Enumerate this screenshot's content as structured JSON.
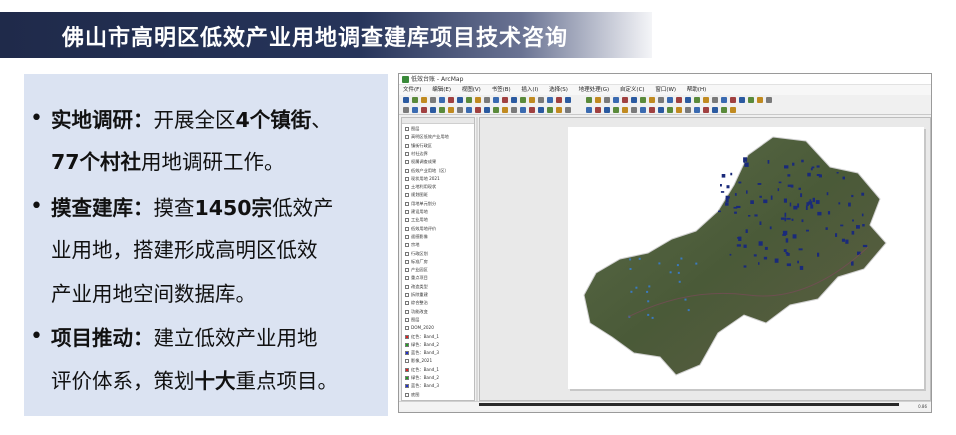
{
  "slide": {
    "title": "佛山市高明区低效产业用地调查建库项目技术咨询"
  },
  "bullets": [
    {
      "lines": [
        [
          {
            "t": "实地调研：",
            "b": true
          },
          {
            "t": "开展全区",
            "b": false
          },
          {
            "t": "4个镇街",
            "b": true
          },
          {
            "t": "、",
            "b": false
          }
        ],
        [
          {
            "t": "77个村社",
            "b": true
          },
          {
            "t": "用地调研工作。",
            "b": false
          }
        ]
      ]
    },
    {
      "lines": [
        [
          {
            "t": "摸查建库：",
            "b": true
          },
          {
            "t": "摸查",
            "b": false
          },
          {
            "t": "1450宗",
            "b": true
          },
          {
            "t": "低效产",
            "b": false
          }
        ],
        [
          {
            "t": "业用地，搭建形成高明区低效",
            "b": false
          }
        ],
        [
          {
            "t": "产业用地空间数据库。",
            "b": false
          }
        ]
      ]
    },
    {
      "lines": [
        [
          {
            "t": "项目推动：",
            "b": true
          },
          {
            "t": "建立低效产业用地",
            "b": false
          }
        ],
        [
          {
            "t": "评价体系，策划",
            "b": false
          },
          {
            "t": "十大",
            "b": true
          },
          {
            "t": "重点项目。",
            "b": false
          }
        ]
      ]
    }
  ],
  "screenshot": {
    "title": "低效台账 - ArcMap",
    "menu": [
      "文件(F)",
      "编辑(E)",
      "视图(V)",
      "书签(B)",
      "插入(I)",
      "选择(S)",
      "地理处理(G)",
      "自定义(C)",
      "窗口(W)",
      "帮助(H)"
    ],
    "status": "0.86",
    "toc_items": [
      "图层",
      "高明区低效产业用地",
      "镇街行政区",
      "村社边界",
      "权属调查成果",
      "低效产业用地（区）",
      "现状用地 2021",
      "土地利用现状",
      "规划图斑",
      "用地单元划分",
      "建设用地",
      "工业用地",
      "低效用地评价",
      "遥感影像",
      "宗地",
      "行政区划",
      "标准厂房",
      "产业园区",
      "重点项目",
      "改造类型",
      "拆除重建",
      "综合整治",
      "功能改变",
      "图层",
      "DOM_2020",
      "红色：Band_1",
      "绿色：Band_2",
      "蓝色：Band_3",
      "影像_2021",
      "红色：Band_1",
      "绿色：Band_2",
      "蓝色：Band_3",
      "底图"
    ],
    "colors": {
      "map_base": "#4a5a38",
      "parcels": "#1a2a7a",
      "boundary": "#cfcfcf"
    }
  }
}
